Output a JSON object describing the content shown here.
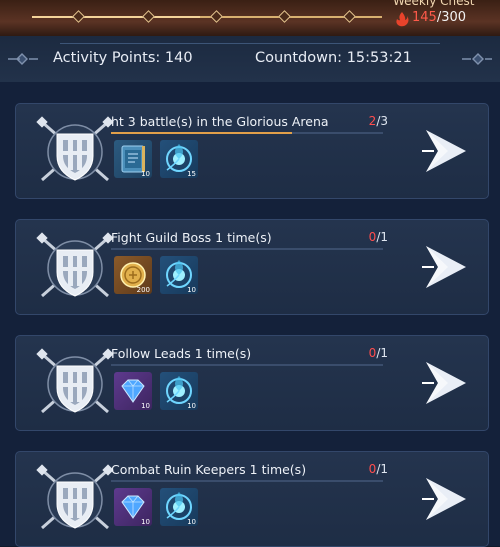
{
  "weekly_chest": {
    "title": "Weekly Chest",
    "current": "145",
    "separator": "/",
    "max": "300",
    "progress": 0.48
  },
  "header": {
    "activity_label": "Activity Points:",
    "activity_value": "140",
    "countdown_label": "Countdown:",
    "countdown_value": "15:53:21"
  },
  "tasks": [
    {
      "title": "ht 3 battle(s) in the Glorious Arena",
      "current": "2",
      "separator": "/",
      "total": "3",
      "progress": 0.667,
      "rewards": [
        {
          "icon": "skill-book-icon",
          "qty": "10"
        },
        {
          "icon": "soul-orb-icon",
          "qty": "15"
        }
      ]
    },
    {
      "title": "Fight Guild Boss 1 time(s)",
      "current": "0",
      "separator": "/",
      "total": "1",
      "progress": 0,
      "rewards": [
        {
          "icon": "gold-coin-icon",
          "qty": "200"
        },
        {
          "icon": "soul-orb-icon",
          "qty": "10"
        }
      ]
    },
    {
      "title": "Follow Leads 1 time(s)",
      "current": "0",
      "separator": "/",
      "total": "1",
      "progress": 0,
      "rewards": [
        {
          "icon": "diamond-icon",
          "qty": "10"
        },
        {
          "icon": "soul-orb-icon",
          "qty": "10"
        }
      ]
    },
    {
      "title": "Combat Ruin Keepers 1 time(s)",
      "current": "0",
      "separator": "/",
      "total": "1",
      "progress": 0,
      "rewards": [
        {
          "icon": "diamond-icon",
          "qty": "10"
        },
        {
          "icon": "soul-orb-icon",
          "qty": "10"
        }
      ]
    }
  ],
  "colors": {
    "progress_current": "#ff4d4d",
    "progress_fill": "#e2a04a",
    "card_bg": "#24344e"
  }
}
